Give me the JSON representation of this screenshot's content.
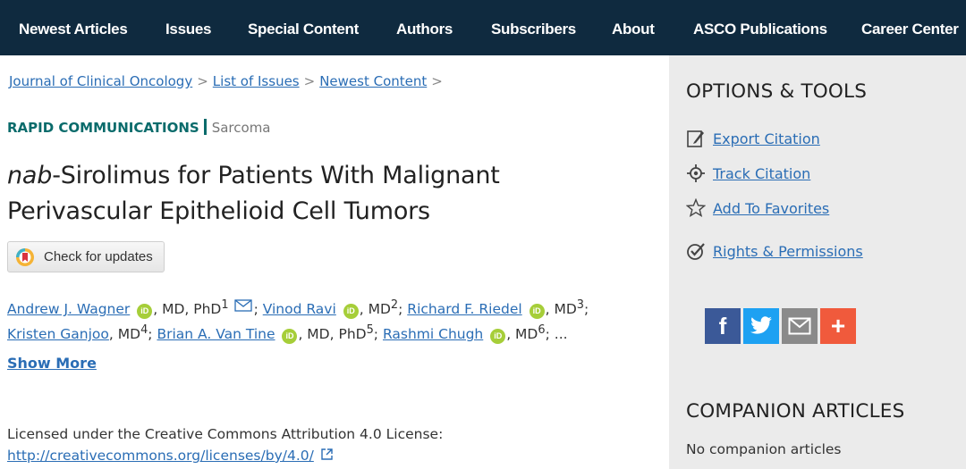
{
  "nav": {
    "items": [
      {
        "label": "Newest Articles"
      },
      {
        "label": "Issues"
      },
      {
        "label": "Special Content"
      },
      {
        "label": "Authors"
      },
      {
        "label": "Subscribers"
      },
      {
        "label": "About"
      },
      {
        "label": "ASCO Publications"
      },
      {
        "label": "Career Center"
      }
    ]
  },
  "breadcrumb": {
    "items": [
      "Journal of Clinical Oncology",
      "List of Issues",
      "Newest Content"
    ],
    "separator": ">"
  },
  "article": {
    "type": "RAPID COMMUNICATIONS",
    "subject": "Sarcoma",
    "title_italic": "nab",
    "title_rest": "-Sirolimus for Patients With Malignant Perivascular Epithelioid Cell Tumors",
    "check_updates_label": "Check for updates",
    "authors": [
      {
        "name": "Andrew J. Wagner",
        "deg": ", MD, PhD",
        "sup": "1"
      },
      {
        "name": "Vinod Ravi",
        "deg": ", MD",
        "sup": "2"
      },
      {
        "name": "Richard F. Riedel",
        "deg": ", MD",
        "sup": "3"
      },
      {
        "name": "Kristen Ganjoo",
        "deg": ", MD",
        "sup": "4"
      },
      {
        "name": "Brian A. Van Tine",
        "deg": ", MD, PhD",
        "sup": "5"
      },
      {
        "name": "Rashmi Chugh",
        "deg": ", MD",
        "sup": "6"
      }
    ],
    "author_sep": ";",
    "ellipsis": "...",
    "show_more_label": "Show More",
    "license_text": "Licensed under the Creative Commons Attribution 4.0 License:",
    "license_url": "http://creativecommons.org/licenses/by/4.0/"
  },
  "sidebar": {
    "options_heading": "OPTIONS & TOOLS",
    "tools": [
      {
        "label": "Export Citation",
        "icon": "export-citation-icon"
      },
      {
        "label": "Track Citation",
        "icon": "track-citation-icon"
      },
      {
        "label": "Add To Favorites",
        "icon": "star-icon"
      },
      {
        "label": "Rights & Permissions",
        "icon": "rights-icon"
      }
    ],
    "share": [
      {
        "name": "facebook",
        "glyph": "f",
        "color": "#3b5998"
      },
      {
        "name": "twitter",
        "glyph": "t",
        "color": "#1da1f2"
      },
      {
        "name": "email",
        "glyph": "",
        "color": "#8a8a8a"
      },
      {
        "name": "more",
        "glyph": "+",
        "color": "#f05a3c"
      }
    ],
    "companion_heading": "COMPANION ARTICLES",
    "companion_empty": "No companion articles"
  },
  "colors": {
    "nav_bg": "#0f2a3f",
    "link": "#2a6db5",
    "section_teal": "#0a6b6b",
    "orcid_green": "#a6ce39",
    "sidebar_bg": "#ebebeb"
  }
}
